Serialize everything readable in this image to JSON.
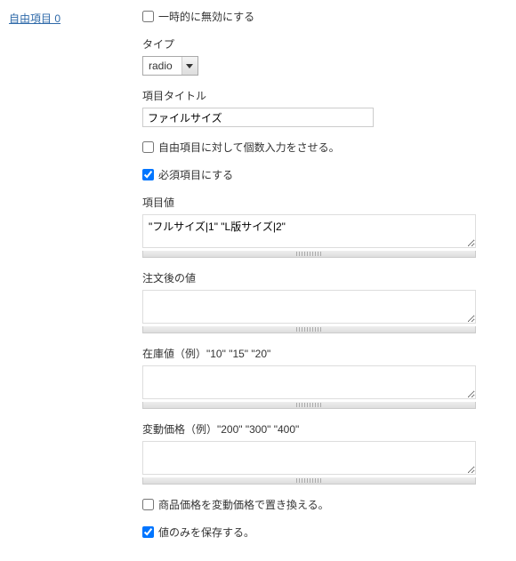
{
  "left_link": "自由項目 0",
  "disable_temp": {
    "label": "一時的に無効にする",
    "checked": false
  },
  "type": {
    "label": "タイプ",
    "value": "radio"
  },
  "item_title": {
    "label": "項目タイトル",
    "value": "ファイルサイズ"
  },
  "multiple_input": {
    "label": "自由項目に対して個数入力をさせる。",
    "checked": false
  },
  "required": {
    "label": "必須項目にする",
    "checked": true
  },
  "item_value": {
    "label": "項目値",
    "value": "\"フルサイズ|1\" \"L版サイズ|2\""
  },
  "after_order": {
    "label": "注文後の値",
    "value": ""
  },
  "stock": {
    "label": "在庫値（例）\"10\" \"15\" \"20\"",
    "value": ""
  },
  "variable_price": {
    "label": "変動価格（例）\"200\" \"300\" \"400\"",
    "value": ""
  },
  "replace_price": {
    "label": "商品価格を変動価格で置き換える。",
    "checked": false
  },
  "save_value_only": {
    "label": "値のみを保存する。",
    "checked": true
  }
}
